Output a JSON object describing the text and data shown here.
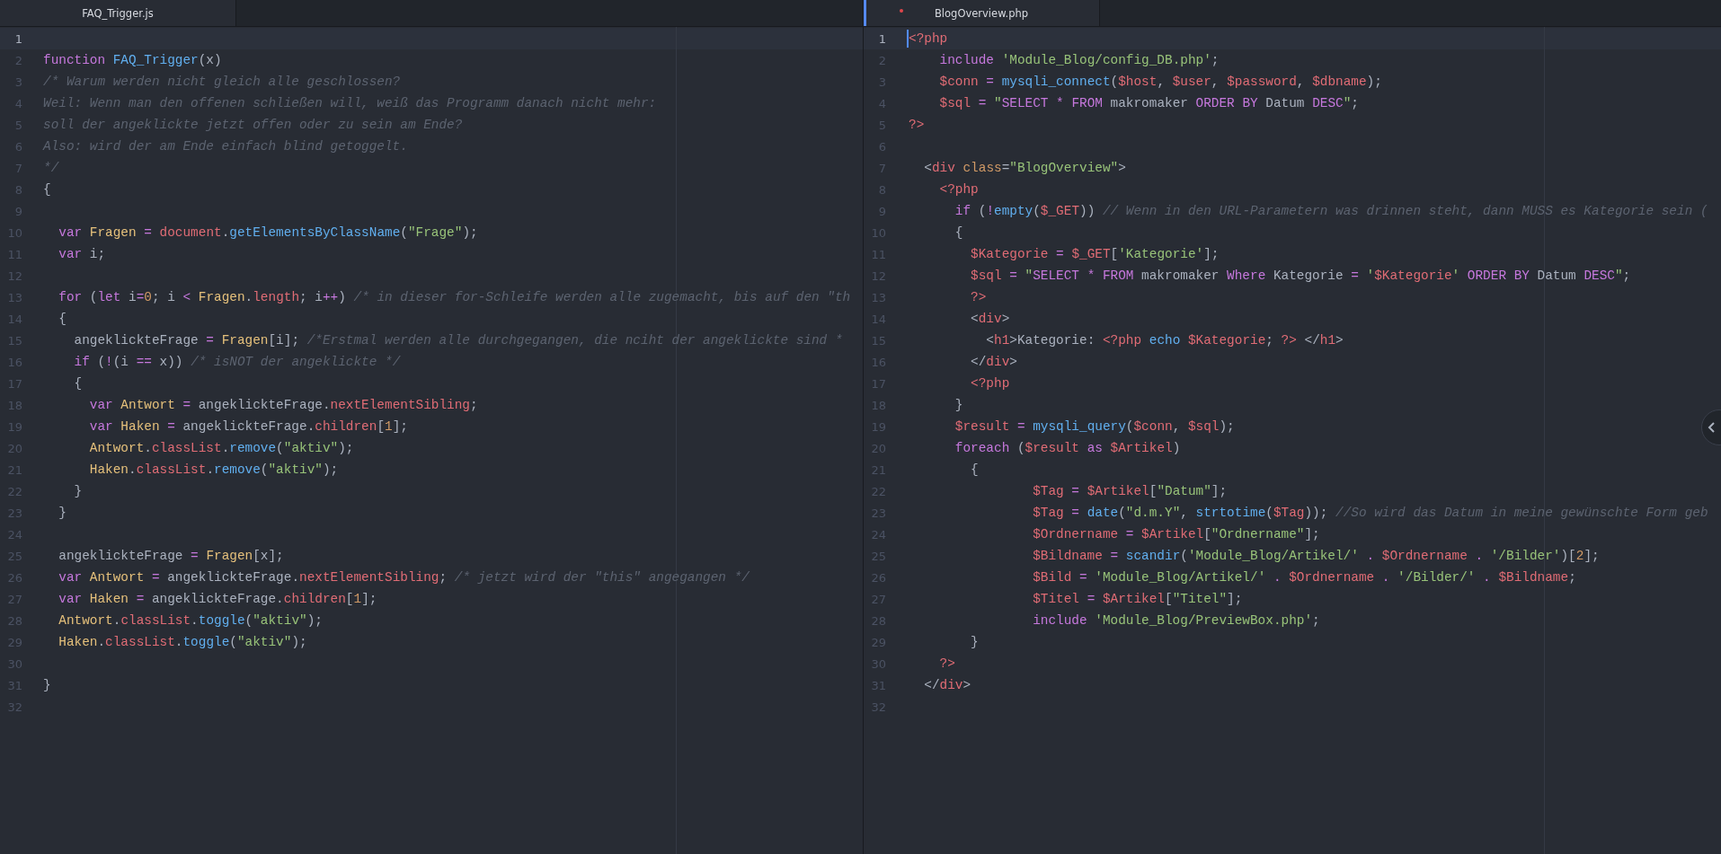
{
  "panes": [
    {
      "focused": false,
      "tab": {
        "label": "FAQ_Trigger.js",
        "selected": true,
        "modified": false
      },
      "lines": [
        {
          "number": "1",
          "current": true
        },
        {
          "number": "2",
          "current": false,
          "tokens": [
            {
              "kind": "keyword",
              "text": "function "
            },
            {
              "kind": "function",
              "text": "FAQ_Trigger"
            },
            {
              "kind": "plain",
              "text": "(x)"
            }
          ]
        },
        {
          "number": "3",
          "current": false,
          "tokens": [
            {
              "kind": "comment",
              "text": "/* Warum werden nicht gleich alle geschlossen?"
            }
          ]
        },
        {
          "number": "4",
          "current": false,
          "tokens": [
            {
              "kind": "comment",
              "text": "Weil: Wenn man den offenen schließen will, weiß das Programm danach nicht mehr:"
            }
          ]
        },
        {
          "number": "5",
          "current": false,
          "tokens": [
            {
              "kind": "comment",
              "text": "soll der angeklickte jetzt offen oder zu sein am Ende?"
            }
          ]
        },
        {
          "number": "6",
          "current": false,
          "tokens": [
            {
              "kind": "comment",
              "text": "Also: wird der am Ende einfach blind getoggelt."
            }
          ]
        },
        {
          "number": "7",
          "current": false,
          "tokens": [
            {
              "kind": "comment",
              "text": "*/"
            }
          ]
        },
        {
          "number": "8",
          "current": false,
          "tokens": [
            {
              "kind": "plain",
              "text": "{"
            }
          ]
        },
        {
          "number": "9",
          "current": false
        },
        {
          "number": "10",
          "current": false,
          "tokens": [
            {
              "kind": "keyword",
              "text": "  var "
            },
            {
              "kind": "class",
              "text": "Fragen "
            },
            {
              "kind": "operator",
              "text": "= "
            },
            {
              "kind": "variable",
              "text": "document"
            },
            {
              "kind": "plain",
              "text": "."
            },
            {
              "kind": "function",
              "text": "getElementsByClassName"
            },
            {
              "kind": "plain",
              "text": "("
            },
            {
              "kind": "string",
              "text": "\"Frage\""
            },
            {
              "kind": "plain",
              "text": ");"
            }
          ]
        },
        {
          "number": "11",
          "current": false,
          "tokens": [
            {
              "kind": "keyword",
              "text": "  var "
            },
            {
              "kind": "plain",
              "text": "i;"
            }
          ]
        },
        {
          "number": "12",
          "current": false
        },
        {
          "number": "13",
          "current": false,
          "tokens": [
            {
              "kind": "keyword",
              "text": "  for "
            },
            {
              "kind": "plain",
              "text": "("
            },
            {
              "kind": "keyword",
              "text": "let "
            },
            {
              "kind": "plain",
              "text": "i"
            },
            {
              "kind": "operator",
              "text": "="
            },
            {
              "kind": "number",
              "text": "0"
            },
            {
              "kind": "plain",
              "text": "; i "
            },
            {
              "kind": "operator",
              "text": "< "
            },
            {
              "kind": "class",
              "text": "Fragen"
            },
            {
              "kind": "plain",
              "text": "."
            },
            {
              "kind": "variable",
              "text": "length"
            },
            {
              "kind": "plain",
              "text": "; i"
            },
            {
              "kind": "operator",
              "text": "++"
            },
            {
              "kind": "plain",
              "text": ") "
            },
            {
              "kind": "comment",
              "text": "/* in dieser for-Schleife werden alle zugemacht, bis auf den \"th"
            }
          ]
        },
        {
          "number": "14",
          "current": false,
          "tokens": [
            {
              "kind": "plain",
              "text": "  {"
            }
          ]
        },
        {
          "number": "15",
          "current": false,
          "tokens": [
            {
              "kind": "plain",
              "text": "    angeklickteFrage "
            },
            {
              "kind": "operator",
              "text": "= "
            },
            {
              "kind": "class",
              "text": "Fragen"
            },
            {
              "kind": "plain",
              "text": "[i]; "
            },
            {
              "kind": "comment",
              "text": "/*Erstmal werden alle durchgegangen, die nciht der angeklickte sind *"
            }
          ]
        },
        {
          "number": "16",
          "current": false,
          "tokens": [
            {
              "kind": "keyword",
              "text": "    if "
            },
            {
              "kind": "plain",
              "text": "("
            },
            {
              "kind": "operator",
              "text": "!"
            },
            {
              "kind": "plain",
              "text": "(i "
            },
            {
              "kind": "operator",
              "text": "== "
            },
            {
              "kind": "plain",
              "text": "x)) "
            },
            {
              "kind": "comment",
              "text": "/* isNOT der angeklickte */"
            }
          ]
        },
        {
          "number": "17",
          "current": false,
          "tokens": [
            {
              "kind": "plain",
              "text": "    {"
            }
          ]
        },
        {
          "number": "18",
          "current": false,
          "tokens": [
            {
              "kind": "keyword",
              "text": "      var "
            },
            {
              "kind": "class",
              "text": "Antwort "
            },
            {
              "kind": "operator",
              "text": "= "
            },
            {
              "kind": "plain",
              "text": "angeklickteFrage."
            },
            {
              "kind": "variable",
              "text": "nextElementSibling"
            },
            {
              "kind": "plain",
              "text": ";"
            }
          ]
        },
        {
          "number": "19",
          "current": false,
          "tokens": [
            {
              "kind": "keyword",
              "text": "      var "
            },
            {
              "kind": "class",
              "text": "Haken "
            },
            {
              "kind": "operator",
              "text": "= "
            },
            {
              "kind": "plain",
              "text": "angeklickteFrage."
            },
            {
              "kind": "variable",
              "text": "children"
            },
            {
              "kind": "plain",
              "text": "["
            },
            {
              "kind": "number",
              "text": "1"
            },
            {
              "kind": "plain",
              "text": "];"
            }
          ]
        },
        {
          "number": "20",
          "current": false,
          "tokens": [
            {
              "kind": "class",
              "text": "      Antwort"
            },
            {
              "kind": "plain",
              "text": "."
            },
            {
              "kind": "variable",
              "text": "classList"
            },
            {
              "kind": "plain",
              "text": "."
            },
            {
              "kind": "function",
              "text": "remove"
            },
            {
              "kind": "plain",
              "text": "("
            },
            {
              "kind": "string",
              "text": "\"aktiv\""
            },
            {
              "kind": "plain",
              "text": ");"
            }
          ]
        },
        {
          "number": "21",
          "current": false,
          "tokens": [
            {
              "kind": "class",
              "text": "      Haken"
            },
            {
              "kind": "plain",
              "text": "."
            },
            {
              "kind": "variable",
              "text": "classList"
            },
            {
              "kind": "plain",
              "text": "."
            },
            {
              "kind": "function",
              "text": "remove"
            },
            {
              "kind": "plain",
              "text": "("
            },
            {
              "kind": "string",
              "text": "\"aktiv\""
            },
            {
              "kind": "plain",
              "text": ");"
            }
          ]
        },
        {
          "number": "22",
          "current": false,
          "tokens": [
            {
              "kind": "plain",
              "text": "    }"
            }
          ]
        },
        {
          "number": "23",
          "current": false,
          "tokens": [
            {
              "kind": "plain",
              "text": "  }"
            }
          ]
        },
        {
          "number": "24",
          "current": false
        },
        {
          "number": "25",
          "current": false,
          "tokens": [
            {
              "kind": "plain",
              "text": "  angeklickteFrage "
            },
            {
              "kind": "operator",
              "text": "= "
            },
            {
              "kind": "class",
              "text": "Fragen"
            },
            {
              "kind": "plain",
              "text": "[x];"
            }
          ]
        },
        {
          "number": "26",
          "current": false,
          "tokens": [
            {
              "kind": "keyword",
              "text": "  var "
            },
            {
              "kind": "class",
              "text": "Antwort "
            },
            {
              "kind": "operator",
              "text": "= "
            },
            {
              "kind": "plain",
              "text": "angeklickteFrage."
            },
            {
              "kind": "variable",
              "text": "nextElementSibling"
            },
            {
              "kind": "plain",
              "text": "; "
            },
            {
              "kind": "comment",
              "text": "/* jetzt wird der \"this\" angegangen */"
            }
          ]
        },
        {
          "number": "27",
          "current": false,
          "tokens": [
            {
              "kind": "keyword",
              "text": "  var "
            },
            {
              "kind": "class",
              "text": "Haken "
            },
            {
              "kind": "operator",
              "text": "= "
            },
            {
              "kind": "plain",
              "text": "angeklickteFrage."
            },
            {
              "kind": "variable",
              "text": "children"
            },
            {
              "kind": "plain",
              "text": "["
            },
            {
              "kind": "number",
              "text": "1"
            },
            {
              "kind": "plain",
              "text": "];"
            }
          ]
        },
        {
          "number": "28",
          "current": false,
          "tokens": [
            {
              "kind": "class",
              "text": "  Antwort"
            },
            {
              "kind": "plain",
              "text": "."
            },
            {
              "kind": "variable",
              "text": "classList"
            },
            {
              "kind": "plain",
              "text": "."
            },
            {
              "kind": "function",
              "text": "toggle"
            },
            {
              "kind": "plain",
              "text": "("
            },
            {
              "kind": "string",
              "text": "\"aktiv\""
            },
            {
              "kind": "plain",
              "text": ");"
            }
          ]
        },
        {
          "number": "29",
          "current": false,
          "tokens": [
            {
              "kind": "class",
              "text": "  Haken"
            },
            {
              "kind": "plain",
              "text": "."
            },
            {
              "kind": "variable",
              "text": "classList"
            },
            {
              "kind": "plain",
              "text": "."
            },
            {
              "kind": "function",
              "text": "toggle"
            },
            {
              "kind": "plain",
              "text": "("
            },
            {
              "kind": "string",
              "text": "\"aktiv\""
            },
            {
              "kind": "plain",
              "text": ");"
            }
          ]
        },
        {
          "number": "30",
          "current": false
        },
        {
          "number": "31",
          "current": false,
          "tokens": [
            {
              "kind": "plain",
              "text": "}"
            }
          ]
        },
        {
          "number": "32",
          "current": false
        }
      ]
    },
    {
      "focused": true,
      "tab": {
        "label": "BlogOverview.php",
        "selected": true,
        "modified": true
      },
      "lines": [
        {
          "number": "1",
          "current": true,
          "tokens": [
            {
              "kind": "tag",
              "text": "<?php"
            }
          ]
        },
        {
          "number": "2",
          "current": false,
          "tokens": [
            {
              "kind": "keyword",
              "text": "    include "
            },
            {
              "kind": "string",
              "text": "'Module_Blog/config_DB.php'"
            },
            {
              "kind": "plain",
              "text": ";"
            }
          ]
        },
        {
          "number": "3",
          "current": false,
          "tokens": [
            {
              "kind": "variable",
              "text": "    $conn "
            },
            {
              "kind": "operator",
              "text": "= "
            },
            {
              "kind": "function",
              "text": "mysqli_connect"
            },
            {
              "kind": "plain",
              "text": "("
            },
            {
              "kind": "variable",
              "text": "$host"
            },
            {
              "kind": "plain",
              "text": ", "
            },
            {
              "kind": "variable",
              "text": "$user"
            },
            {
              "kind": "plain",
              "text": ", "
            },
            {
              "kind": "variable",
              "text": "$password"
            },
            {
              "kind": "plain",
              "text": ", "
            },
            {
              "kind": "variable",
              "text": "$dbname"
            },
            {
              "kind": "plain",
              "text": ");"
            }
          ]
        },
        {
          "number": "4",
          "current": false,
          "tokens": [
            {
              "kind": "variable",
              "text": "    $sql "
            },
            {
              "kind": "operator",
              "text": "= "
            },
            {
              "kind": "string",
              "text": "\""
            },
            {
              "kind": "keyword",
              "text": "SELECT * FROM "
            },
            {
              "kind": "plain",
              "text": "makromaker "
            },
            {
              "kind": "keyword",
              "text": "ORDER BY "
            },
            {
              "kind": "plain",
              "text": "Datum "
            },
            {
              "kind": "keyword",
              "text": "DESC"
            },
            {
              "kind": "string",
              "text": "\""
            },
            {
              "kind": "plain",
              "text": ";"
            }
          ]
        },
        {
          "number": "5",
          "current": false,
          "tokens": [
            {
              "kind": "tag",
              "text": "?>"
            }
          ]
        },
        {
          "number": "6",
          "current": false
        },
        {
          "number": "7",
          "current": false,
          "tokens": [
            {
              "kind": "plain",
              "text": "  <"
            },
            {
              "kind": "tag",
              "text": "div "
            },
            {
              "kind": "attribute",
              "text": "class"
            },
            {
              "kind": "plain",
              "text": "="
            },
            {
              "kind": "string",
              "text": "\"BlogOverview\""
            },
            {
              "kind": "plain",
              "text": ">"
            }
          ]
        },
        {
          "number": "8",
          "current": false,
          "tokens": [
            {
              "kind": "tag",
              "text": "    <?php"
            }
          ]
        },
        {
          "number": "9",
          "current": false,
          "tokens": [
            {
              "kind": "keyword",
              "text": "      if "
            },
            {
              "kind": "plain",
              "text": "("
            },
            {
              "kind": "operator",
              "text": "!"
            },
            {
              "kind": "function",
              "text": "empty"
            },
            {
              "kind": "plain",
              "text": "("
            },
            {
              "kind": "variable",
              "text": "$_GET"
            },
            {
              "kind": "plain",
              "text": ")) "
            },
            {
              "kind": "comment",
              "text": "// Wenn in den URL-Parametern was drinnen steht, dann MUSS es Kategorie sein ("
            }
          ]
        },
        {
          "number": "10",
          "current": false,
          "tokens": [
            {
              "kind": "plain",
              "text": "      {"
            }
          ]
        },
        {
          "number": "11",
          "current": false,
          "tokens": [
            {
              "kind": "variable",
              "text": "        $Kategorie "
            },
            {
              "kind": "operator",
              "text": "= "
            },
            {
              "kind": "variable",
              "text": "$_GET"
            },
            {
              "kind": "plain",
              "text": "["
            },
            {
              "kind": "string",
              "text": "'Kategorie'"
            },
            {
              "kind": "plain",
              "text": "];"
            }
          ]
        },
        {
          "number": "12",
          "current": false,
          "tokens": [
            {
              "kind": "variable",
              "text": "        $sql "
            },
            {
              "kind": "operator",
              "text": "= "
            },
            {
              "kind": "string",
              "text": "\""
            },
            {
              "kind": "keyword",
              "text": "SELECT * FROM "
            },
            {
              "kind": "plain",
              "text": "makromaker "
            },
            {
              "kind": "keyword",
              "text": "Where "
            },
            {
              "kind": "plain",
              "text": "Kategorie "
            },
            {
              "kind": "operator",
              "text": "= "
            },
            {
              "kind": "string",
              "text": "'"
            },
            {
              "kind": "variable",
              "text": "$Kategorie"
            },
            {
              "kind": "string",
              "text": "'"
            },
            {
              "kind": "keyword",
              "text": " ORDER BY "
            },
            {
              "kind": "plain",
              "text": "Datum "
            },
            {
              "kind": "keyword",
              "text": "DESC"
            },
            {
              "kind": "string",
              "text": "\""
            },
            {
              "kind": "plain",
              "text": ";"
            }
          ]
        },
        {
          "number": "13",
          "current": false,
          "tokens": [
            {
              "kind": "tag",
              "text": "        ?>"
            }
          ]
        },
        {
          "number": "14",
          "current": false,
          "tokens": [
            {
              "kind": "plain",
              "text": "        <"
            },
            {
              "kind": "tag",
              "text": "div"
            },
            {
              "kind": "plain",
              "text": ">"
            }
          ]
        },
        {
          "number": "15",
          "current": false,
          "tokens": [
            {
              "kind": "plain",
              "text": "          <"
            },
            {
              "kind": "tag",
              "text": "h1"
            },
            {
              "kind": "plain",
              "text": ">Kategorie: "
            },
            {
              "kind": "tag",
              "text": "<?php "
            },
            {
              "kind": "function",
              "text": "echo "
            },
            {
              "kind": "variable",
              "text": "$Kategorie"
            },
            {
              "kind": "plain",
              "text": "; "
            },
            {
              "kind": "tag",
              "text": "?> "
            },
            {
              "kind": "plain",
              "text": "</"
            },
            {
              "kind": "tag",
              "text": "h1"
            },
            {
              "kind": "plain",
              "text": ">"
            }
          ]
        },
        {
          "number": "16",
          "current": false,
          "tokens": [
            {
              "kind": "plain",
              "text": "        </"
            },
            {
              "kind": "tag",
              "text": "div"
            },
            {
              "kind": "plain",
              "text": ">"
            }
          ]
        },
        {
          "number": "17",
          "current": false,
          "tokens": [
            {
              "kind": "tag",
              "text": "        <?php"
            }
          ]
        },
        {
          "number": "18",
          "current": false,
          "tokens": [
            {
              "kind": "plain",
              "text": "      }"
            }
          ]
        },
        {
          "number": "19",
          "current": false,
          "tokens": [
            {
              "kind": "variable",
              "text": "      $result "
            },
            {
              "kind": "operator",
              "text": "= "
            },
            {
              "kind": "function",
              "text": "mysqli_query"
            },
            {
              "kind": "plain",
              "text": "("
            },
            {
              "kind": "variable",
              "text": "$conn"
            },
            {
              "kind": "plain",
              "text": ", "
            },
            {
              "kind": "variable",
              "text": "$sql"
            },
            {
              "kind": "plain",
              "text": ");"
            }
          ]
        },
        {
          "number": "20",
          "current": false,
          "tokens": [
            {
              "kind": "keyword",
              "text": "      foreach "
            },
            {
              "kind": "plain",
              "text": "("
            },
            {
              "kind": "variable",
              "text": "$result "
            },
            {
              "kind": "keyword",
              "text": "as "
            },
            {
              "kind": "variable",
              "text": "$Artikel"
            },
            {
              "kind": "plain",
              "text": ")"
            }
          ]
        },
        {
          "number": "21",
          "current": false,
          "tokens": [
            {
              "kind": "plain",
              "text": "        {"
            }
          ]
        },
        {
          "number": "22",
          "current": false,
          "tokens": [
            {
              "kind": "variable",
              "text": "                $Tag "
            },
            {
              "kind": "operator",
              "text": "= "
            },
            {
              "kind": "variable",
              "text": "$Artikel"
            },
            {
              "kind": "plain",
              "text": "["
            },
            {
              "kind": "string",
              "text": "\"Datum\""
            },
            {
              "kind": "plain",
              "text": "];"
            }
          ]
        },
        {
          "number": "23",
          "current": false,
          "tokens": [
            {
              "kind": "variable",
              "text": "                $Tag "
            },
            {
              "kind": "operator",
              "text": "= "
            },
            {
              "kind": "function",
              "text": "date"
            },
            {
              "kind": "plain",
              "text": "("
            },
            {
              "kind": "string",
              "text": "\"d.m.Y\""
            },
            {
              "kind": "plain",
              "text": ", "
            },
            {
              "kind": "function",
              "text": "strtotime"
            },
            {
              "kind": "plain",
              "text": "("
            },
            {
              "kind": "variable",
              "text": "$Tag"
            },
            {
              "kind": "plain",
              "text": ")); "
            },
            {
              "kind": "comment",
              "text": "//So wird das Datum in meine gewünschte Form geb"
            }
          ]
        },
        {
          "number": "24",
          "current": false,
          "tokens": [
            {
              "kind": "variable",
              "text": "                $Ordnername "
            },
            {
              "kind": "operator",
              "text": "= "
            },
            {
              "kind": "variable",
              "text": "$Artikel"
            },
            {
              "kind": "plain",
              "text": "["
            },
            {
              "kind": "string",
              "text": "\"Ordnername\""
            },
            {
              "kind": "plain",
              "text": "];"
            }
          ]
        },
        {
          "number": "25",
          "current": false,
          "tokens": [
            {
              "kind": "variable",
              "text": "                $Bildname "
            },
            {
              "kind": "operator",
              "text": "= "
            },
            {
              "kind": "function",
              "text": "scandir"
            },
            {
              "kind": "plain",
              "text": "("
            },
            {
              "kind": "string",
              "text": "'Module_Blog/Artikel/' "
            },
            {
              "kind": "operator",
              "text": ". "
            },
            {
              "kind": "variable",
              "text": "$Ordnername "
            },
            {
              "kind": "operator",
              "text": ". "
            },
            {
              "kind": "string",
              "text": "'/Bilder'"
            },
            {
              "kind": "plain",
              "text": ")["
            },
            {
              "kind": "number",
              "text": "2"
            },
            {
              "kind": "plain",
              "text": "];"
            }
          ]
        },
        {
          "number": "26",
          "current": false,
          "tokens": [
            {
              "kind": "variable",
              "text": "                $Bild "
            },
            {
              "kind": "operator",
              "text": "= "
            },
            {
              "kind": "string",
              "text": "'Module_Blog/Artikel/' "
            },
            {
              "kind": "operator",
              "text": ". "
            },
            {
              "kind": "variable",
              "text": "$Ordnername "
            },
            {
              "kind": "operator",
              "text": ". "
            },
            {
              "kind": "string",
              "text": "'/Bilder/' "
            },
            {
              "kind": "operator",
              "text": ". "
            },
            {
              "kind": "variable",
              "text": "$Bildname"
            },
            {
              "kind": "plain",
              "text": ";"
            }
          ]
        },
        {
          "number": "27",
          "current": false,
          "tokens": [
            {
              "kind": "variable",
              "text": "                $Titel "
            },
            {
              "kind": "operator",
              "text": "= "
            },
            {
              "kind": "variable",
              "text": "$Artikel"
            },
            {
              "kind": "plain",
              "text": "["
            },
            {
              "kind": "string",
              "text": "\"Titel\""
            },
            {
              "kind": "plain",
              "text": "];"
            }
          ]
        },
        {
          "number": "28",
          "current": false,
          "tokens": [
            {
              "kind": "keyword",
              "text": "                include "
            },
            {
              "kind": "string",
              "text": "'Module_Blog/PreviewBox.php'"
            },
            {
              "kind": "plain",
              "text": ";"
            }
          ]
        },
        {
          "number": "29",
          "current": false,
          "tokens": [
            {
              "kind": "plain",
              "text": "        }"
            }
          ]
        },
        {
          "number": "30",
          "current": false,
          "tokens": [
            {
              "kind": "tag",
              "text": "    ?>"
            }
          ]
        },
        {
          "number": "31",
          "current": false,
          "tokens": [
            {
              "kind": "plain",
              "text": "  </"
            },
            {
              "kind": "tag",
              "text": "div"
            },
            {
              "kind": "plain",
              "text": ">"
            }
          ]
        },
        {
          "number": "32",
          "current": false
        }
      ]
    }
  ]
}
